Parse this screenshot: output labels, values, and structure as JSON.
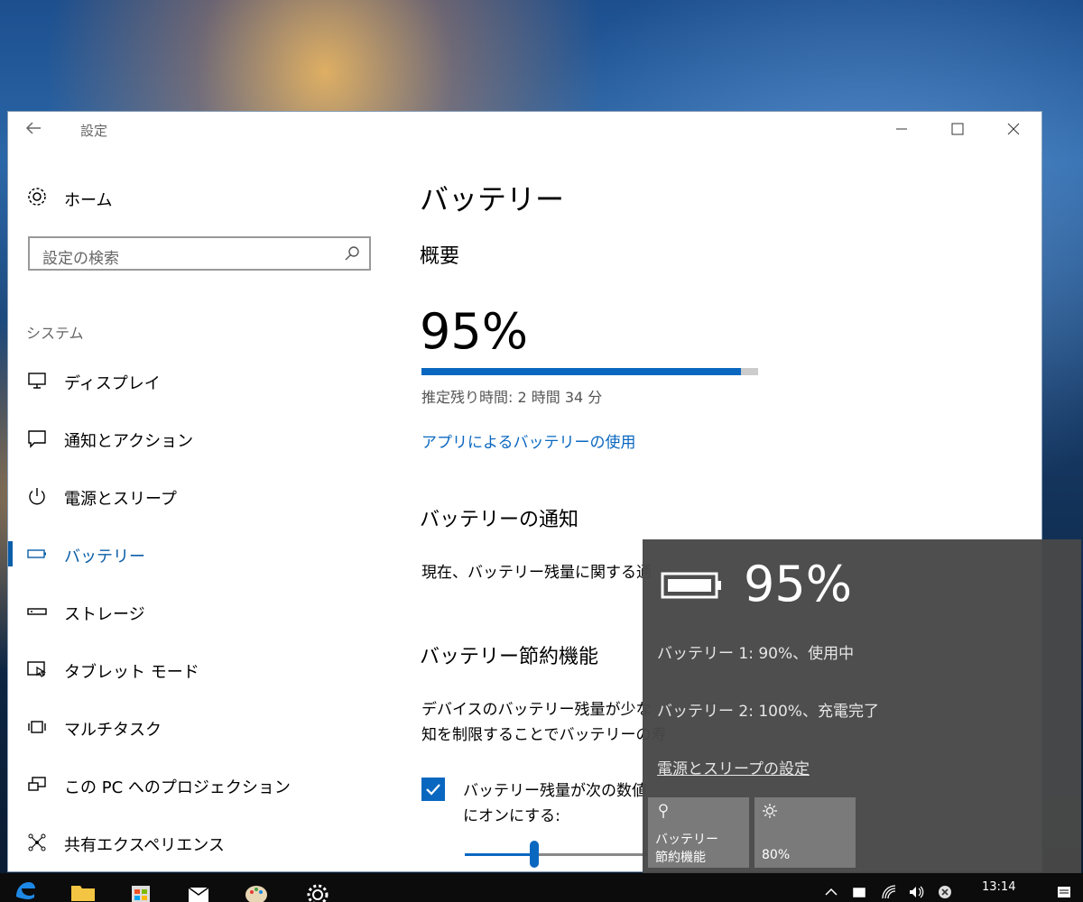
{
  "window": {
    "title": "設定",
    "back_icon": "arrow-left-icon",
    "controls": {
      "minimize": "—",
      "maximize": "☐",
      "close": "✕"
    }
  },
  "sidebar": {
    "home_label": "ホーム",
    "search_placeholder": "設定の検索",
    "section_label": "システム",
    "items": [
      {
        "label": "ディスプレイ",
        "icon": "monitor-icon",
        "active": false
      },
      {
        "label": "通知とアクション",
        "icon": "notification-icon",
        "active": false
      },
      {
        "label": "電源とスリープ",
        "icon": "power-icon",
        "active": false
      },
      {
        "label": "バッテリー",
        "icon": "battery-icon",
        "active": true
      },
      {
        "label": "ストレージ",
        "icon": "storage-icon",
        "active": false
      },
      {
        "label": "タブレット モード",
        "icon": "tablet-mode-icon",
        "active": false
      },
      {
        "label": "マルチタスク",
        "icon": "multitask-icon",
        "active": false
      },
      {
        "label": "この PC へのプロジェクション",
        "icon": "projection-icon",
        "active": false
      },
      {
        "label": "共有エクスペリエンス",
        "icon": "shared-experience-icon",
        "active": false
      }
    ]
  },
  "main": {
    "title": "バッテリー",
    "overview_heading": "概要",
    "percent": "95%",
    "progress_fraction": 0.95,
    "estimate": "推定残り時間: 2 時間 34 分",
    "usage_link": "アプリによるバッテリーの使用",
    "notify_heading": "バッテリーの通知",
    "notify_text": "現在、バッテリー残量に関する通",
    "saver_heading": "バッテリー節約機能",
    "saver_desc_line1": "デバイスのバッテリー残量が少な",
    "saver_desc_line2": "知を制限することでバッテリーの寿",
    "checkbox_checked": true,
    "checkbox_line1": "バッテリー残量が次の数値",
    "checkbox_line2": "にオンにする:",
    "slider_fraction": 0.35
  },
  "flyout": {
    "percent": "95%",
    "battery1": "バッテリー 1: 90%、使用中",
    "battery2": "バッテリー 2: 100%、充電完了",
    "settings_link": "電源とスリープの設定",
    "tile_saver_line1": "バッテリー",
    "tile_saver_line2": "節約機能",
    "tile_brightness": "80%"
  },
  "taskbar": {
    "time": "13:14",
    "apps": [
      "edge-icon",
      "file-explorer-icon",
      "store-icon",
      "mail-icon",
      "paint-icon",
      "settings-icon"
    ]
  },
  "colors": {
    "accent": "#0a67c0",
    "flyout_bg": "#484848",
    "tile_bg": "#7a7a7a"
  }
}
